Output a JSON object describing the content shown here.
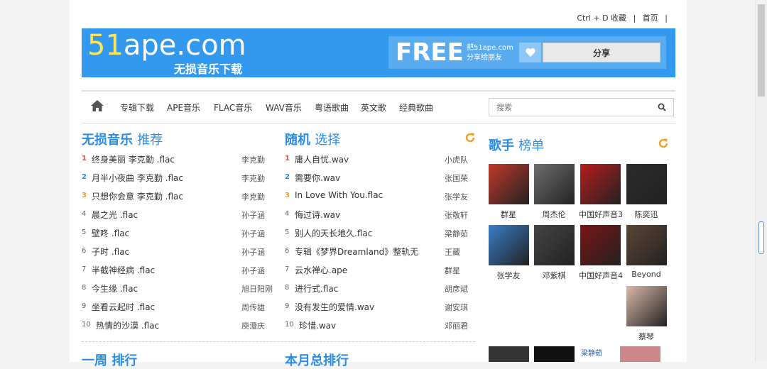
{
  "toplinks": {
    "bookmark": "Ctrl + D 收藏",
    "sep1": "|",
    "home": "首页",
    "sep2": "|"
  },
  "banner": {
    "logo_num": "51",
    "logo_rest": "ape.com",
    "logo_sub": "无损音乐下载",
    "free": "FREE",
    "free_note_1": "把51ape.com",
    "free_note_2": "分享给朋友",
    "share_label": "分享"
  },
  "nav": {
    "items": [
      "专辑下载",
      "APE音乐",
      "FLAC音乐",
      "WAV音乐",
      "粤语歌曲",
      "英文歌",
      "经典歌曲"
    ],
    "search_placeholder": "搜索"
  },
  "lossless": {
    "title_a": "无损音乐",
    "title_b": "推荐",
    "songs": [
      {
        "idx": "1",
        "title": "终身美丽 李克勤 .flac",
        "artist": "李克勤"
      },
      {
        "idx": "2",
        "title": "月半小夜曲 李克勤 .flac",
        "artist": "李克勤"
      },
      {
        "idx": "3",
        "title": "只想你会意 李克勤 .flac",
        "artist": "李克勤"
      },
      {
        "idx": "4",
        "title": "晨之光 .flac",
        "artist": "孙子涵"
      },
      {
        "idx": "5",
        "title": "壁咚 .flac",
        "artist": "孙子涵"
      },
      {
        "idx": "6",
        "title": "子时 .flac",
        "artist": "孙子涵"
      },
      {
        "idx": "7",
        "title": "半截神经病 .flac",
        "artist": "孙子涵"
      },
      {
        "idx": "8",
        "title": "今生缘 .flac",
        "artist": "旭日阳刚"
      },
      {
        "idx": "9",
        "title": "坐看云起时 .flac",
        "artist": "周传雄"
      },
      {
        "idx": "10",
        "title": "热情的沙漠 .flac",
        "artist": "庾澄庆"
      }
    ]
  },
  "random": {
    "title_a": "随机",
    "title_b": "选择",
    "songs": [
      {
        "idx": "1",
        "title": "庸人自忧.wav",
        "artist": "小虎队"
      },
      {
        "idx": "2",
        "title": "需要你.wav",
        "artist": "张国荣"
      },
      {
        "idx": "3",
        "title": "In Love With You.flac",
        "artist": "张学友"
      },
      {
        "idx": "4",
        "title": "悔过诗.wav",
        "artist": "张敬轩"
      },
      {
        "idx": "5",
        "title": "别人的天长地久.flac",
        "artist": "梁静茹"
      },
      {
        "idx": "6",
        "title": "专辑《梦界Dreamland》整轨无",
        "artist": "王藏"
      },
      {
        "idx": "7",
        "title": "云水禅心.ape",
        "artist": "群星"
      },
      {
        "idx": "8",
        "title": "进行式.flac",
        "artist": "胡彦斌"
      },
      {
        "idx": "9",
        "title": "没有发生的爱情.wav",
        "artist": "谢安琪"
      },
      {
        "idx": "10",
        "title": "珍惜.wav",
        "artist": "邓丽君"
      }
    ]
  },
  "singers": {
    "title_a": "歌手",
    "title_b": "榜单",
    "items": [
      {
        "name": "群星",
        "color": "#c0392b"
      },
      {
        "name": "周杰伦",
        "color": "#6d6d6d"
      },
      {
        "name": "中国好声音3",
        "color": "#b71c1c"
      },
      {
        "name": "陈奕迅",
        "color": "#2c2c2c"
      },
      {
        "name": "张学友",
        "color": "#3a7cc7"
      },
      {
        "name": "邓紫棋",
        "color": "#444444"
      },
      {
        "name": "中国好声音4",
        "color": "#7b1414"
      },
      {
        "name": "Beyond",
        "color": "#5a4636"
      },
      {
        "name": "蔡琴",
        "color": "#d9b8a8"
      }
    ],
    "partial_alt": "梁静茹"
  },
  "bottom": {
    "week_title": "一周 排行",
    "month_title": "本月总排行"
  }
}
